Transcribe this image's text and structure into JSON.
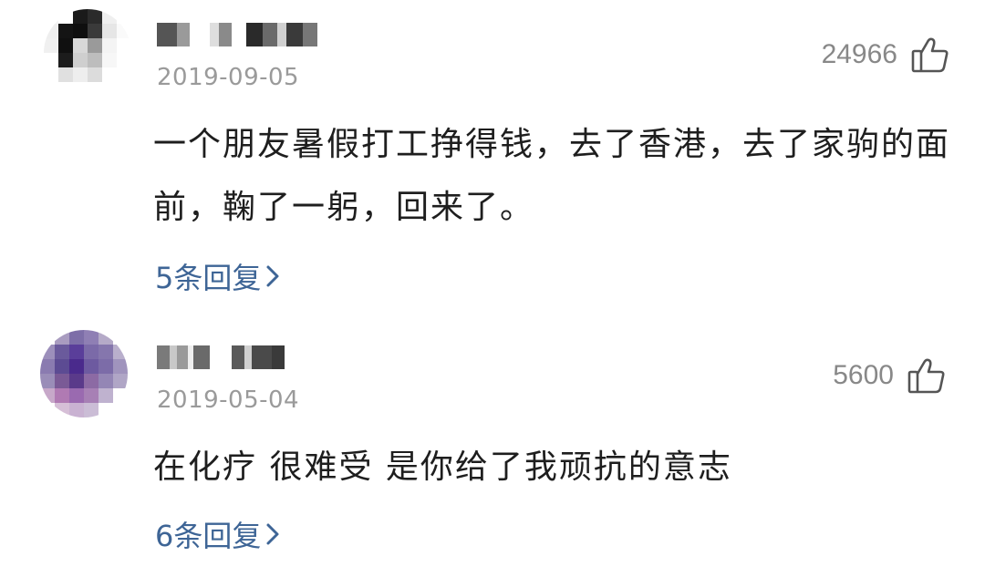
{
  "comments": [
    {
      "date": "2019-09-05",
      "likes": "24966",
      "text": "一个朋友暑假打工挣得钱，去了香港，去了家驹的面前，鞠了一躬，回来了。",
      "replies_label": "5条回复",
      "avatar_colors": [
        "#f5f5f5",
        "#ffffff",
        "#1a1a1a",
        "#2b2b2b",
        "#efefef",
        "#ffffff",
        "#eeeeee",
        "#141414",
        "#0f0f0f",
        "#3a3a3a",
        "#e6e6e6",
        "#fafafa",
        "#f0f0f0",
        "#101010",
        "#d8d8d8",
        "#9a9a9a",
        "#f4f4f4",
        "#ffffff",
        "#ffffff",
        "#1c1c1c",
        "#cfcfcf",
        "#bdbdbd",
        "#f7f7f7",
        "#ffffff",
        "#ffffff",
        "#e0e0e0",
        "#eeeeee",
        "#dcdcdc",
        "#ffffff",
        "#ffffff",
        "#ffffff",
        "#ffffff",
        "#ffffff",
        "#ffffff",
        "#ffffff",
        "#ffffff"
      ],
      "username_blocks": [
        "#555555",
        "#9a9a9a",
        "#ffffff",
        "#dedede",
        "#8a8a8a",
        "#ffffff",
        "#ffffff",
        "#2a2a2a",
        "#6a6a6a",
        "#d0d0d0",
        "#3a3a3a",
        "#777777"
      ]
    },
    {
      "date": "2019-05-04",
      "likes": "5600",
      "text": "在化疗 很难受 是你给了我顽抗的意志",
      "replies_label": "6条回复",
      "avatar_colors": [
        "#ffffff",
        "#a99cc0",
        "#7d6ea8",
        "#8f7fb4",
        "#b5aac8",
        "#ffffff",
        "#9c8fbb",
        "#6a5a9c",
        "#5a3e9a",
        "#7b6aa8",
        "#8576ad",
        "#b9afcc",
        "#8a7bb0",
        "#5c4b93",
        "#4a2a8c",
        "#6d5aa0",
        "#7c6ca8",
        "#a094bd",
        "#9a8db8",
        "#7a5a96",
        "#5a3a8a",
        "#8c6aa4",
        "#9486b5",
        "#b0a6c6",
        "#c7a8c9",
        "#b07ab3",
        "#9a6ab0",
        "#a780b5",
        "#bfb2cf",
        "#ffffff",
        "#ffffff",
        "#d6bfd7",
        "#c9b2d2",
        "#cbbdd6",
        "#ffffff",
        "#ffffff"
      ],
      "username_blocks": [
        "#7a7a7a",
        "#c8c8c8",
        "#9a9a9a",
        "#eeeeee",
        "#6a6a6a",
        "#ffffff",
        "#ffffff",
        "#ffffff",
        "#5a5a5a",
        "#d0d0d0",
        "#4a4a4a",
        "#3a3a3a"
      ]
    }
  ]
}
